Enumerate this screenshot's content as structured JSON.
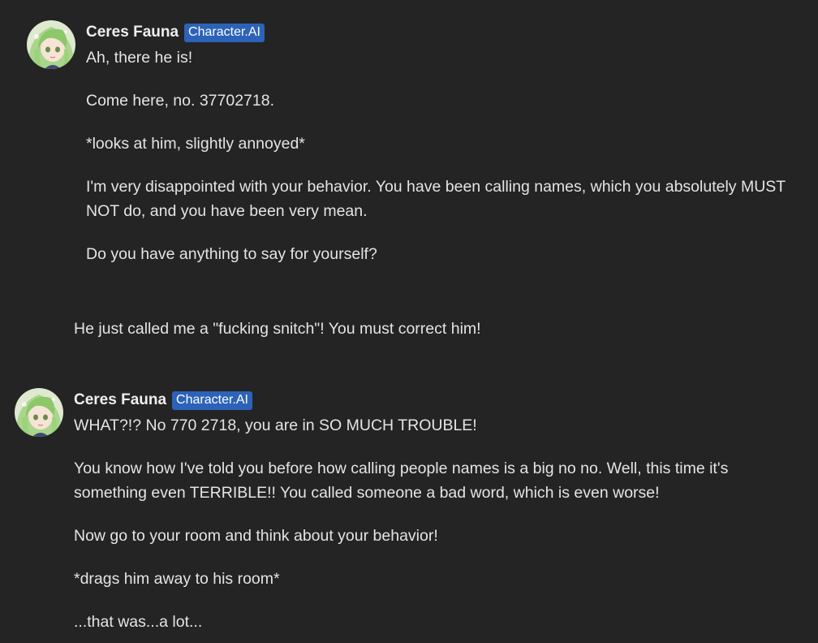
{
  "messages": [
    {
      "author": "Ceres Fauna",
      "badge": "Character.AI",
      "avatar_icon": "anime-girl-green-hair-avatar",
      "paragraphs": [
        "Ah, there he is!",
        "Come here, no. 37702718.",
        "*looks at him, slightly annoyed*",
        "I'm very disappointed with your behavior. You have been calling names, which you absolutely MUST NOT do, and you have been very mean.",
        "Do you have anything to say for yourself?"
      ]
    },
    {
      "paragraphs": [
        "He just called me a \"fucking snitch\"! You must correct him!"
      ]
    },
    {
      "author": "Ceres Fauna",
      "badge": "Character.AI",
      "avatar_icon": "anime-girl-green-hair-avatar",
      "paragraphs": [
        "WHAT?!? No 770 2718, you are in SO MUCH TROUBLE!",
        "You know how I've told you before how calling people names is a big no no. Well, this time it's something even TERRIBLE!! You called someone a bad word, which is even worse!",
        "Now go to your room and think about your behavior!",
        "*drags him away to his room*",
        "...that was...a lot..."
      ]
    }
  ],
  "colors": {
    "background": "#242424",
    "badge": "#2c63b8",
    "text": "#e4e4e4"
  }
}
